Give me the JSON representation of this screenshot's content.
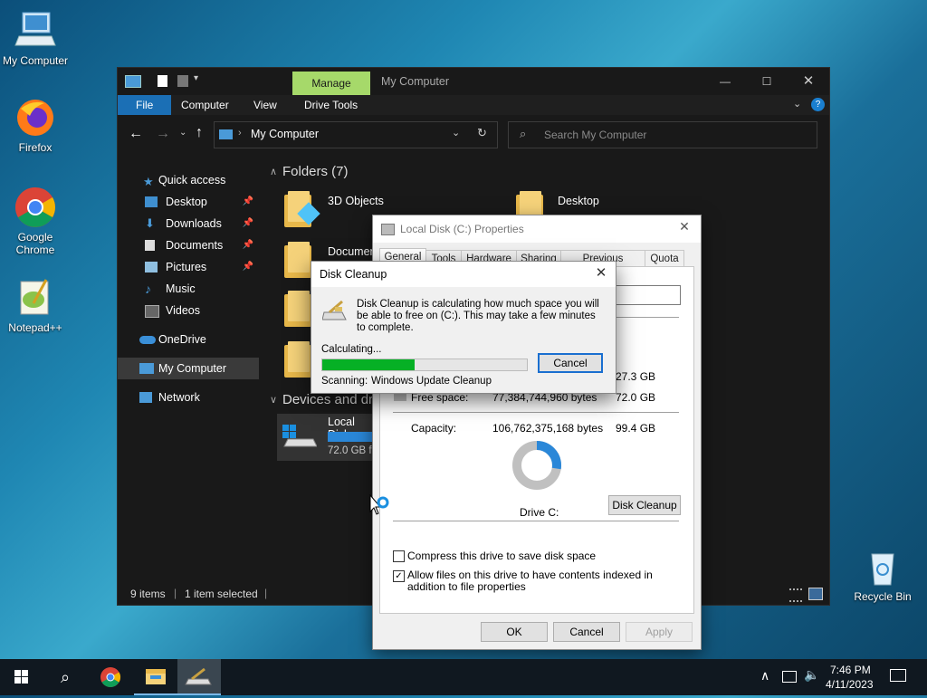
{
  "desktop": {
    "icons": [
      {
        "label": "My Computer"
      },
      {
        "label": "Firefox"
      },
      {
        "label": "Google Chrome"
      },
      {
        "label": "Notepad++"
      },
      {
        "label": "Recycle Bin"
      }
    ]
  },
  "explorer": {
    "title": "My Computer",
    "manage_tab": "Manage",
    "ribbon_tabs": [
      "File",
      "Computer",
      "View",
      "Drive Tools"
    ],
    "address": "My Computer",
    "search_placeholder": "Search My Computer",
    "nav": [
      {
        "label": "Quick access"
      },
      {
        "label": "Desktop"
      },
      {
        "label": "Downloads"
      },
      {
        "label": "Documents"
      },
      {
        "label": "Pictures"
      },
      {
        "label": "Music"
      },
      {
        "label": "Videos"
      },
      {
        "label": "OneDrive"
      },
      {
        "label": "My Computer"
      },
      {
        "label": "Network"
      }
    ],
    "folders_header": "Folders (7)",
    "folders": [
      {
        "label": "3D Objects"
      },
      {
        "label": "Desktop"
      },
      {
        "label": "Documen"
      }
    ],
    "devices_header": "Devices and dri",
    "drive_label": "Local Disk",
    "drive_free": "72.0 GB fr",
    "status_items": "9 items",
    "status_selected": "1 item selected"
  },
  "properties": {
    "title": "Local Disk (C:) Properties",
    "tabs": [
      "General",
      "Tools",
      "Hardware",
      "Sharing",
      "Previous Versions",
      "Quota"
    ],
    "used_gb": "27.3 GB",
    "free_label": "Free space:",
    "free_bytes": "77,384,744,960 bytes",
    "free_gb": "72.0 GB",
    "capacity_label": "Capacity:",
    "capacity_bytes": "106,762,375,168 bytes",
    "capacity_gb": "99.4 GB",
    "drive_label": "Drive C:",
    "cleanup_button": "Disk Cleanup",
    "used_fraction": 0.275,
    "compress_label": "Compress this drive to save disk space",
    "compress_checked": false,
    "index_label": "Allow files on this drive to have contents indexed in addition to file properties",
    "index_checked": true,
    "ok": "OK",
    "cancel": "Cancel",
    "apply": "Apply"
  },
  "cleanup": {
    "title": "Disk Cleanup",
    "message": "Disk Cleanup is calculating how much space you will be able to free on  (C:). This may take a few minutes to complete.",
    "calculating": "Calculating...",
    "cancel": "Cancel",
    "progress": 0.45,
    "scanning_label": "Scanning:",
    "scanning_item": "Windows Update Cleanup"
  },
  "taskbar": {
    "time": "7:46 PM",
    "date": "4/11/2023"
  },
  "colors": {
    "accent": "#1a7fd0",
    "progress": "#06b025",
    "manage_tab": "#a6d96a"
  }
}
